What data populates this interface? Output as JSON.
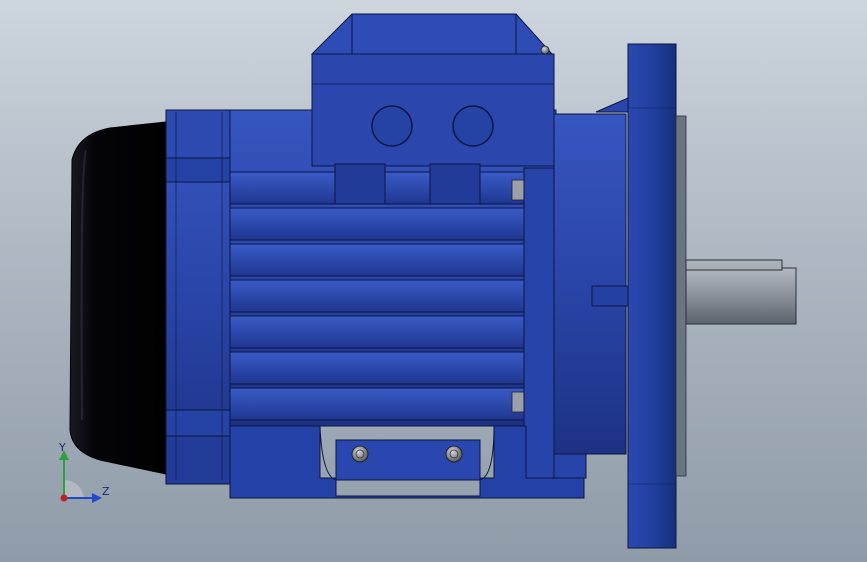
{
  "viewport": {
    "background_top": "#cdd5dd",
    "background_bottom": "#8f9ba8"
  },
  "model": {
    "name": "electric-motor",
    "body_color": "#2a45a8",
    "body_dark": "#1b2f7c",
    "body_light": "#3a5cc8",
    "outline_color": "#0c1640",
    "fan_cover_color": "#0a0a10",
    "shaft_color": "#8e959d",
    "bolt_color": "#8a8f99"
  },
  "triad": {
    "y_label": "Y",
    "z_label": "Z",
    "y_color": "#2fa040",
    "z_color": "#2348d0",
    "origin_color": "#c02020",
    "icon": "coordinate-triad-icon"
  }
}
